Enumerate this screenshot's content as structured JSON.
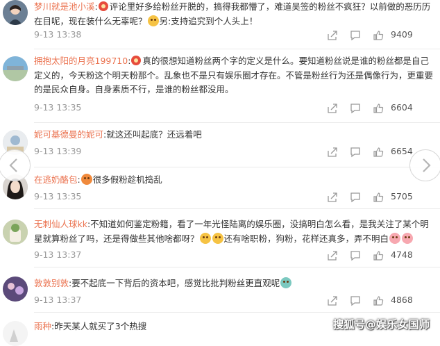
{
  "comments": [
    {
      "username": "梦川就是池小溪",
      "text_a": "评论里好多给粉丝开脱的，搞得我都懵了，难道吴签的粉丝不疯狂？以前做的恶历历在目呢，现在装什么无辜呢？",
      "text_b": "另:支持追究到个人头上！",
      "time": "9-13 13:38",
      "likes": "9409"
    },
    {
      "username": "拥抱太阳的月亮199710",
      "text_a": "真的很想知道粉丝两个字的定义是什么。要知道粉丝说是谁的粉丝都是自己定义的，今天粉这个明天粉那个。乱象也不是只有娱乐圈才存在。不管是粉丝行为还是偶像行为，更重要的是民众自身。自身素质不行，是谁的粉丝都没用。",
      "time": "9-13 13:35",
      "likes": "6604"
    },
    {
      "username": "妮可基德曼的妮可",
      "text_a": "就这还叫起底？还远着吧",
      "time": "9-13 13:39",
      "likes": "6654"
    },
    {
      "username": "在逃奶酪包",
      "text_a": "很多假粉趁机捣乱",
      "time": "9-13 13:35",
      "likes": "5705"
    },
    {
      "username": "无刺仙人球kk",
      "text_a": "不知道如何鉴定粉籍，看了一年光怪陆离的娱乐圈，没搞明白怎么看，是我关注了某个明星就算粉丝了吗，还是得做些其他啥都呀？",
      "text_b": "还有啥职粉，狗粉，花样还真多，弄不明白",
      "time": "9-13 13:37",
      "likes": "4748"
    },
    {
      "username": "敦敦别敦",
      "text_a": "要不起底一下背后的资本吧，感觉比批判粉丝更直观呢",
      "time": "9-13 13:37",
      "likes": "4868"
    },
    {
      "username": "雨种",
      "text_a": "昨天某人就买了3个热搜"
    }
  ],
  "icons": {
    "share": "share-icon",
    "comment": "comment-icon",
    "like": "thumbs-up-icon",
    "prev": "chevron-left-icon",
    "next": "chevron-right-icon"
  },
  "colors": {
    "username": "#eb7350",
    "meta": "#999999",
    "text": "#333333"
  },
  "watermark": "搜狐号@娱乐女国师"
}
